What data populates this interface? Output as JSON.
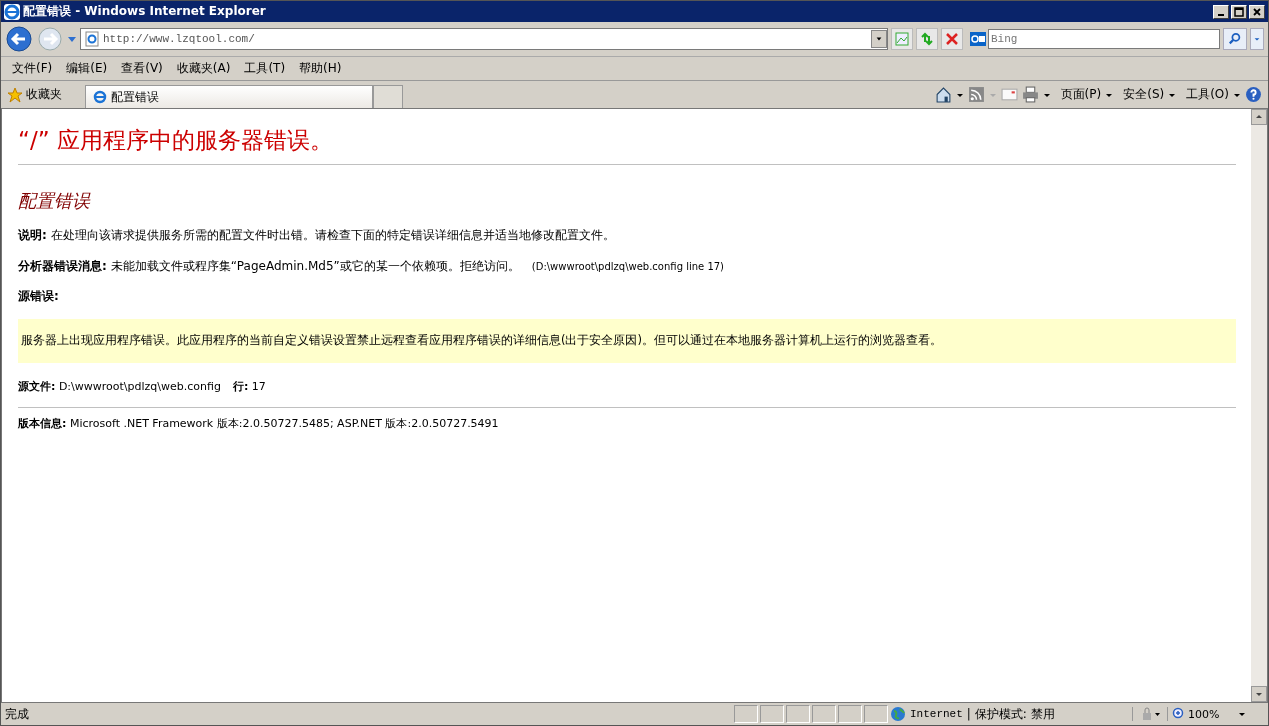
{
  "window": {
    "title": "配置错误 - Windows Internet Explorer"
  },
  "address_bar": {
    "url": "http://www.lzqtool.com/"
  },
  "search": {
    "placeholder": "Bing"
  },
  "menu": [
    "文件(F)",
    "编辑(E)",
    "查看(V)",
    "收藏夹(A)",
    "工具(T)",
    "帮助(H)"
  ],
  "favorites": {
    "label": "收藏夹"
  },
  "tabs": [
    {
      "label": "配置错误",
      "selected": true
    }
  ],
  "command_bar": [
    "页面(P)",
    "安全(S)",
    "工具(O)"
  ],
  "page": {
    "heading": "“/” 应用程序中的服务器错误。",
    "subheading": "配置错误",
    "description": "**说明:** 在处理向该请求提供服务所需的配置文件时出错。请检查下面的特定错误详细信息并适当地修改配置文件。",
    "parser_message": "**分析器错误消息:** 未能加载文件或程序集“PageAdmin.Md5”或它的某一个依赖项。拒绝访问。",
    "parser_location": "(D:\\wwwroot\\pdlzq\\web.config line 17)",
    "source_error_label": "源错误:",
    "source_error_text": "服务器上出现应用程序错误。此应用程序的当前自定义错误设置禁止远程查看应用程序错误的详细信息(出于安全原因)。但可以通过在本地服务器计算机上运行的浏览器查看。",
    "source_file": "**源文件:** D:\\wwwroot\\pdlzq\\web.config",
    "source_line": "**行:** 17",
    "version": "**版本信息:** Microsoft .NET Framework 版本:2.0.50727.5485; ASP.NET 版本:2.0.50727.5491"
  },
  "status_bar": {
    "text": "完成",
    "zone": "Internet",
    "separator": "|",
    "protected_mode": "保护模式: 禁用",
    "zoom": "100%"
  }
}
